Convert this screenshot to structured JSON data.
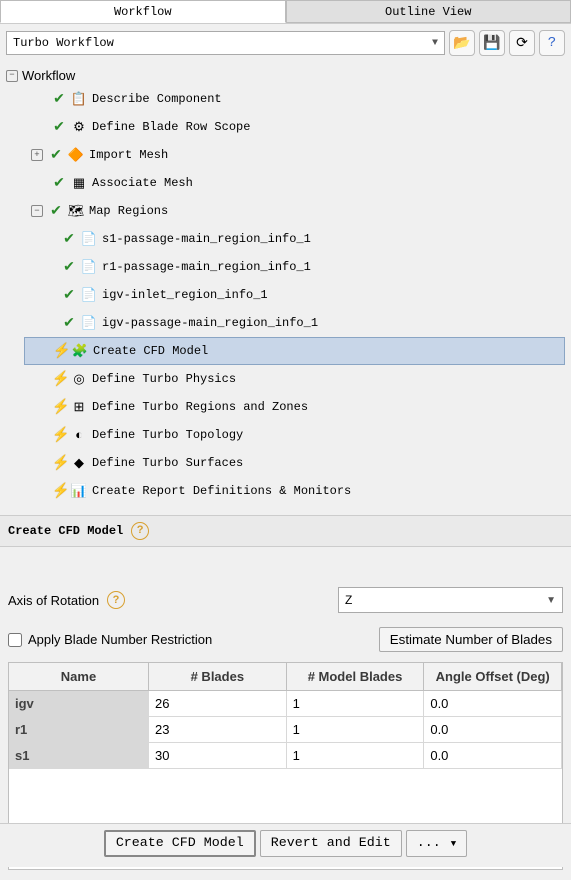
{
  "tabs": {
    "workflow": "Workflow",
    "outline": "Outline View"
  },
  "toolbar": {
    "dropdown_value": "Turbo Workflow"
  },
  "tree": {
    "root": "Workflow",
    "items": [
      {
        "status": "check",
        "icon": "📋",
        "label": "Describe Component",
        "key": "describe-component"
      },
      {
        "status": "check",
        "icon": "⚙",
        "label": "Define Blade Row Scope",
        "key": "blade-row-scope"
      },
      {
        "status": "check",
        "icon": "🔶",
        "label": "Import Mesh",
        "key": "import-mesh",
        "toggle": "+"
      },
      {
        "status": "check",
        "icon": "▦",
        "label": "Associate Mesh",
        "key": "associate-mesh"
      },
      {
        "status": "check",
        "icon": "🗺",
        "label": "Map Regions",
        "key": "map-regions",
        "toggle": "−",
        "children": [
          {
            "status": "check",
            "icon": "📄",
            "label": "s1-passage-main_region_info_1"
          },
          {
            "status": "check",
            "icon": "📄",
            "label": "r1-passage-main_region_info_1"
          },
          {
            "status": "check",
            "icon": "📄",
            "label": "igv-inlet_region_info_1"
          },
          {
            "status": "check",
            "icon": "📄",
            "label": "igv-passage-main_region_info_1"
          }
        ]
      },
      {
        "status": "bolt",
        "icon": "🧩",
        "label": "Create CFD Model",
        "key": "create-cfd",
        "selected": true
      },
      {
        "status": "bolt",
        "icon": "◎",
        "label": "Define Turbo Physics",
        "key": "turbo-physics"
      },
      {
        "status": "bolt",
        "icon": "⊞",
        "label": "Define Turbo Regions and Zones",
        "key": "turbo-regions"
      },
      {
        "status": "bolt",
        "icon": "◐",
        "label": "Define Turbo Topology",
        "key": "turbo-topology"
      },
      {
        "status": "bolt",
        "icon": "◆",
        "label": "Define Turbo Surfaces",
        "key": "turbo-surfaces"
      },
      {
        "status": "bolt",
        "icon": "📊",
        "label": "Create Report Definitions & Monitors",
        "key": "create-report"
      }
    ]
  },
  "panel": {
    "title": "Create CFD Model",
    "axis_label": "Axis of Rotation",
    "axis_value": "Z",
    "apply_restriction_label": "Apply Blade Number Restriction",
    "estimate_button": "Estimate Number of Blades",
    "table": {
      "headers": [
        "Name",
        "# Blades",
        "# Model Blades",
        "Angle Offset (Deg)"
      ],
      "rows": [
        {
          "name": "igv",
          "blades": "26",
          "model": "1",
          "offset": "0.0"
        },
        {
          "name": "r1",
          "blades": "23",
          "model": "1",
          "offset": "0.0"
        },
        {
          "name": "s1",
          "blades": "30",
          "model": "1",
          "offset": "0.0"
        }
      ]
    }
  },
  "footer": {
    "create": "Create CFD Model",
    "revert": "Revert and Edit",
    "more": "..."
  },
  "colors": {
    "selection": "#c8d6e8",
    "check": "#2a8a2a",
    "bolt": "#f0c020"
  }
}
